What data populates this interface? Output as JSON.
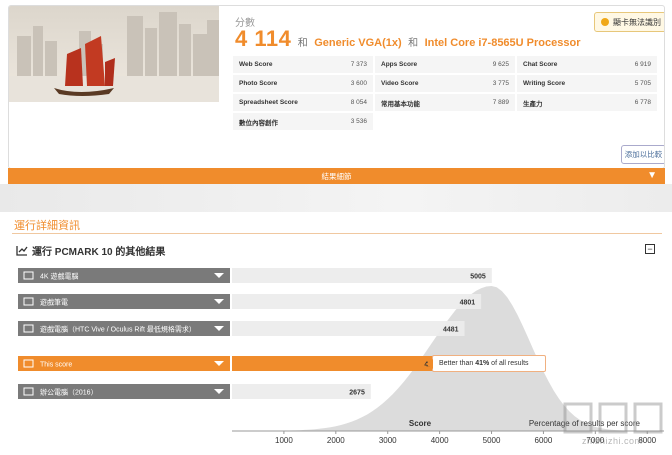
{
  "summary": {
    "score_label": "分數",
    "score_value": "4 114",
    "connector": "和",
    "gpu": "Generic VGA(1x)",
    "cpu": "Intel Core i7-8565U Processor",
    "detect_button": "顯卡無法識別",
    "compare_button": "添加以比較",
    "subscores": [
      [
        {
          "label": "Web Score",
          "value": "7 373"
        },
        {
          "label": "Apps Score",
          "value": "9 625"
        },
        {
          "label": "Chat Score",
          "value": "6 919"
        }
      ],
      [
        {
          "label": "Photo Score",
          "value": "3 600"
        },
        {
          "label": "Video Score",
          "value": "3 775"
        },
        {
          "label": "Writing Score",
          "value": "5 705"
        }
      ],
      [
        {
          "label": "Spreadsheet Score",
          "value": "8 054"
        },
        {
          "label": "常用基本功能",
          "value": "7 889"
        },
        {
          "label": "生產力",
          "value": "6 778"
        }
      ],
      [
        {
          "label": "數位內容創作",
          "value": "3 536"
        }
      ]
    ]
  },
  "result_bar": {
    "label": "結果細節"
  },
  "details": {
    "title": "運行詳細資訊",
    "other_results_title": "運行 PCMARK 10 的其他結果",
    "better_than_prefix": "Better than",
    "better_than_percent": "41%",
    "better_than_suffix": "of all results"
  },
  "chart_data": {
    "type": "bar",
    "orientation": "horizontal",
    "categories": [
      "4K 遊戲電腦",
      "遊戲筆電",
      "遊戲電腦（HTC Vive / Oculus Rift 最低規格需求）",
      "This score",
      "辦公電腦（2016）"
    ],
    "values": [
      5005,
      4801,
      4481,
      4114,
      2675
    ],
    "highlight": "This score",
    "xlabel": "Score",
    "ylabel": "Percentage of results per score",
    "xticks": [
      1000,
      2000,
      3000,
      4000,
      5000,
      6000,
      7000,
      8000
    ],
    "xlim": [
      0,
      8400
    ],
    "distribution_peak": 5000,
    "colors": {
      "bar": "#7a7a7a",
      "highlight": "#f08c2c",
      "distribution": "#dcdcdc",
      "accent": "#f08c2c"
    }
  },
  "watermark": {
    "text": "zhizhizhi.com"
  }
}
